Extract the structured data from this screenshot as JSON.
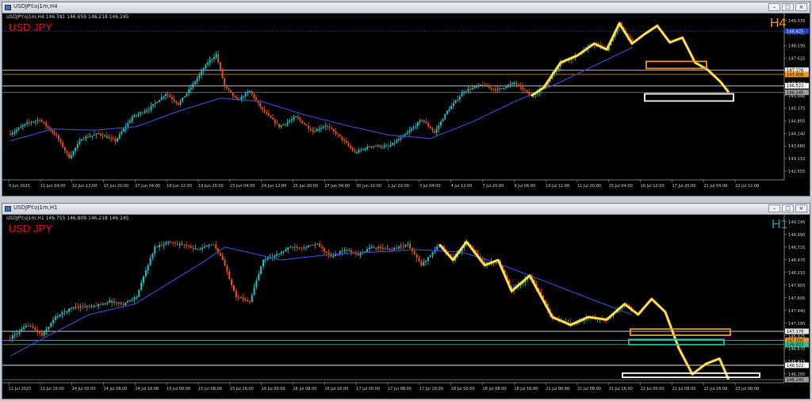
{
  "windows": [
    {
      "id": "h4",
      "title": "USDJPY.oj1m,H4",
      "info": "USDJPY.oj1m,H4  146.391 146.659 146.218 146.245",
      "symbol_label": "USD JPY",
      "timeframe_label": "H4",
      "timeframe_color": "#f29a17",
      "buttons": [
        "–",
        "□",
        "×"
      ]
    },
    {
      "id": "h1",
      "title": "USDJPY.oj1m,H1",
      "info": "USDJPY.oj1m,H1  146.755 146.809 146.218 146.245",
      "symbol_label": "USD JPY",
      "timeframe_label": "H1",
      "timeframe_color": "#1d9aa3",
      "buttons": [
        "–",
        "□",
        "×"
      ]
    }
  ],
  "chart_data": [
    {
      "type": "candlestick",
      "timeframe": "H4",
      "ylim": [
        142.555,
        149.435
      ],
      "y_ticks": [
        "149.335",
        "148.765",
        "148.195",
        "147.625",
        "147.175",
        "146.510",
        "145.940",
        "145.375",
        "144.805",
        "144.240",
        "143.680",
        "143.110",
        "142.555"
      ],
      "x_labels": [
        "9 Jun 2025",
        "11 Jun 04:00",
        "12 Jun 12:00",
        "13 Jun 20:00",
        "17 Jun 04:00",
        "18 Jun 12:00",
        "19 Jun 20:00",
        "23 Jun 04:00",
        "24 Jun 12:00",
        "25 Jun 20:00",
        "27 Jun 04:00",
        "30 Jun 12:00",
        "1 Jul 20:00",
        "3 Jul 04:00",
        "4 Jul 12:00",
        "7 Jul 20:00",
        "9 Jul 04:00",
        "10 Jul 12:00",
        "11 Jul 20:00",
        "15 Jul 04:00",
        "16 Jul 12:00",
        "17 Jul 20:00",
        "21 Jul 04:00",
        "22 Jul 12:00"
      ],
      "anchors": [
        [
          0,
          144.5
        ],
        [
          8,
          144.95
        ],
        [
          14,
          145.1
        ],
        [
          22,
          144.4
        ],
        [
          28,
          143.5
        ],
        [
          34,
          144.3
        ],
        [
          42,
          144.5
        ],
        [
          50,
          144.2
        ],
        [
          58,
          145.2
        ],
        [
          66,
          145.55
        ],
        [
          74,
          146.2
        ],
        [
          80,
          145.75
        ],
        [
          86,
          146.45
        ],
        [
          94,
          147.5
        ],
        [
          98,
          147.85
        ],
        [
          102,
          146.5
        ],
        [
          108,
          145.9
        ],
        [
          114,
          146.3
        ],
        [
          120,
          145.5
        ],
        [
          128,
          144.8
        ],
        [
          136,
          145.2
        ],
        [
          144,
          144.6
        ],
        [
          150,
          144.85
        ],
        [
          156,
          144.45
        ],
        [
          164,
          143.7
        ],
        [
          172,
          144.0
        ],
        [
          180,
          143.95
        ],
        [
          188,
          144.45
        ],
        [
          196,
          145.1
        ],
        [
          202,
          144.55
        ],
        [
          208,
          145.45
        ],
        [
          216,
          146.3
        ],
        [
          224,
          146.55
        ],
        [
          232,
          146.35
        ],
        [
          240,
          146.65
        ],
        [
          248,
          146.1
        ],
        [
          254,
          146.45
        ],
        [
          262,
          147.5
        ],
        [
          270,
          147.8
        ],
        [
          278,
          148.3
        ],
        [
          284,
          148.05
        ],
        [
          290,
          149.15
        ],
        [
          296,
          148.3
        ],
        [
          302,
          148.7
        ],
        [
          308,
          149.05
        ],
        [
          314,
          148.35
        ],
        [
          320,
          148.55
        ],
        [
          326,
          147.5
        ],
        [
          332,
          147.2
        ],
        [
          338,
          146.7
        ],
        [
          342,
          146.25
        ]
      ],
      "ma_anchors": [
        [
          0,
          144.2
        ],
        [
          20,
          144.7
        ],
        [
          40,
          144.65
        ],
        [
          60,
          144.8
        ],
        [
          80,
          145.45
        ],
        [
          100,
          146.0
        ],
        [
          120,
          145.85
        ],
        [
          140,
          145.3
        ],
        [
          160,
          144.85
        ],
        [
          180,
          144.45
        ],
        [
          200,
          144.3
        ],
        [
          220,
          145.0
        ],
        [
          240,
          145.85
        ],
        [
          260,
          146.6
        ],
        [
          280,
          147.45
        ],
        [
          300,
          148.3
        ],
        [
          315,
          148.6
        ],
        [
          330,
          148.3
        ],
        [
          342,
          147.7
        ]
      ],
      "zigzag_from": 248,
      "horizontal_lines": [
        {
          "price": 148.825,
          "color": "#2a50ff",
          "style": "dotted"
        },
        {
          "price": 147.176,
          "color": "#e6e6e6"
        },
        {
          "price": 147.0,
          "color": "#f29a17"
        },
        {
          "price": 146.522,
          "color": "#ffffff"
        },
        {
          "price": 146.24,
          "color": "#7a7a7a"
        }
      ],
      "price_tags": [
        {
          "text": "148.825",
          "bg": "#1f3fc9",
          "fg": "#ffffff",
          "price": 148.825
        },
        {
          "text": "147.176",
          "bg": "#e6e6e6",
          "fg": "#000000",
          "price": 147.176
        },
        {
          "text": "147.000",
          "bg": "#f29a17",
          "fg": "#000000",
          "price": 147.0
        },
        {
          "text": "146.522",
          "bg": "#ffffff",
          "fg": "#000000",
          "price": 146.522
        },
        {
          "text": "146.245",
          "bg": "#9a9a9a",
          "fg": "#000000",
          "price": 146.245
        }
      ],
      "zones": [
        {
          "color": "#f29a17",
          "x0": 812,
          "x1": 888,
          "p0": 147.55,
          "p1": 147.25
        },
        {
          "color": "#ffffff",
          "x0": 810,
          "x1": 922,
          "p0": 146.18,
          "p1": 145.88
        }
      ]
    },
    {
      "type": "candlestick",
      "timeframe": "H1",
      "ylim": [
        146.185,
        149.36
      ],
      "y_ticks": [
        "149.245",
        "148.990",
        "148.725",
        "148.470",
        "148.210",
        "147.955",
        "147.695",
        "147.440",
        "147.185",
        "146.925",
        "146.670",
        "146.415",
        "146.185"
      ],
      "x_labels": [
        "11 Jul 2025",
        "11 Jul 16:00",
        "14 Jul 00:00",
        "14 Jul 08:00",
        "14 Jul 16:00",
        "15 Jul 00:00",
        "15 Jul 08:00",
        "15 Jul 16:00",
        "16 Jul 00:00",
        "16 Jul 08:00",
        "16 Jul 16:00",
        "17 Jul 00:00",
        "17 Jul 08:00",
        "17 Jul 16:00",
        "18 Jul 00:00",
        "18 Jul 08:00",
        "18 Jul 16:00",
        "21 Jul 00:00",
        "21 Jul 08:00",
        "21 Jul 16:00",
        "22 Jul 00:00",
        "22 Jul 08:00",
        "22 Jul 16:00",
        "23 Jul 00:00"
      ],
      "anchors": [
        [
          0,
          147.05
        ],
        [
          8,
          147.3
        ],
        [
          14,
          147.1
        ],
        [
          20,
          147.45
        ],
        [
          28,
          147.65
        ],
        [
          36,
          147.65
        ],
        [
          44,
          147.75
        ],
        [
          50,
          147.7
        ],
        [
          56,
          147.85
        ],
        [
          60,
          148.35
        ],
        [
          64,
          148.8
        ],
        [
          70,
          148.9
        ],
        [
          76,
          148.85
        ],
        [
          82,
          148.75
        ],
        [
          90,
          148.85
        ],
        [
          94,
          148.55
        ],
        [
          100,
          147.85
        ],
        [
          106,
          147.75
        ],
        [
          112,
          148.55
        ],
        [
          118,
          148.65
        ],
        [
          124,
          148.8
        ],
        [
          130,
          148.8
        ],
        [
          136,
          148.85
        ],
        [
          142,
          148.6
        ],
        [
          148,
          148.75
        ],
        [
          154,
          148.65
        ],
        [
          160,
          148.8
        ],
        [
          168,
          148.75
        ],
        [
          176,
          148.85
        ],
        [
          182,
          148.45
        ],
        [
          190,
          148.85
        ],
        [
          196,
          148.55
        ],
        [
          202,
          148.9
        ],
        [
          210,
          148.45
        ],
        [
          216,
          148.55
        ],
        [
          222,
          147.95
        ],
        [
          230,
          148.25
        ],
        [
          240,
          147.45
        ],
        [
          248,
          147.3
        ],
        [
          256,
          147.45
        ],
        [
          264,
          147.4
        ],
        [
          272,
          147.7
        ],
        [
          278,
          147.5
        ],
        [
          284,
          147.8
        ],
        [
          290,
          147.55
        ],
        [
          296,
          146.85
        ],
        [
          302,
          146.35
        ],
        [
          308,
          146.55
        ],
        [
          314,
          146.65
        ],
        [
          318,
          146.25
        ]
      ],
      "ma_anchors": [
        [
          0,
          146.7
        ],
        [
          15,
          147.05
        ],
        [
          35,
          147.5
        ],
        [
          55,
          147.7
        ],
        [
          70,
          148.1
        ],
        [
          85,
          148.5
        ],
        [
          95,
          148.8
        ],
        [
          105,
          148.7
        ],
        [
          120,
          148.55
        ],
        [
          140,
          148.65
        ],
        [
          160,
          148.7
        ],
        [
          180,
          148.75
        ],
        [
          200,
          148.7
        ],
        [
          215,
          148.5
        ],
        [
          230,
          148.25
        ],
        [
          245,
          148.0
        ],
        [
          260,
          147.75
        ],
        [
          275,
          147.5
        ],
        [
          290,
          147.25
        ],
        [
          305,
          147.05
        ],
        [
          318,
          146.7
        ]
      ],
      "zigzag_from": 190,
      "horizontal_lines": [
        {
          "price": 147.176,
          "color": "#e6e6e6"
        },
        {
          "price": 147.0,
          "color": "#f29a17"
        },
        {
          "price": 146.922,
          "color": "#2fbf8c"
        },
        {
          "price": 146.522,
          "color": "#ffffff"
        },
        {
          "price": 146.245,
          "color": "#7a7a7a"
        }
      ],
      "price_tags": [
        {
          "text": "147.176",
          "bg": "#e6e6e6",
          "fg": "#000000",
          "price": 147.176
        },
        {
          "text": "147.000",
          "bg": "#f29a17",
          "fg": "#000000",
          "price": 147.0
        },
        {
          "text": "146.922",
          "bg": "#2fbf8c",
          "fg": "#000000",
          "price": 146.922
        },
        {
          "text": "146.522",
          "bg": "#ffffff",
          "fg": "#000000",
          "price": 146.522
        },
        {
          "text": "146.245",
          "bg": "#9a9a9a",
          "fg": "#000000",
          "price": 146.245
        }
      ],
      "zones": [
        {
          "color": "#f29a17",
          "x0": 792,
          "x1": 918,
          "p0": 147.22,
          "p1": 147.1
        },
        {
          "color": "#2fbf8c",
          "x0": 790,
          "x1": 910,
          "p0": 147.02,
          "p1": 146.92
        },
        {
          "color": "#ffffff",
          "x0": 782,
          "x1": 955,
          "p0": 146.37,
          "p1": 146.29
        }
      ]
    }
  ]
}
